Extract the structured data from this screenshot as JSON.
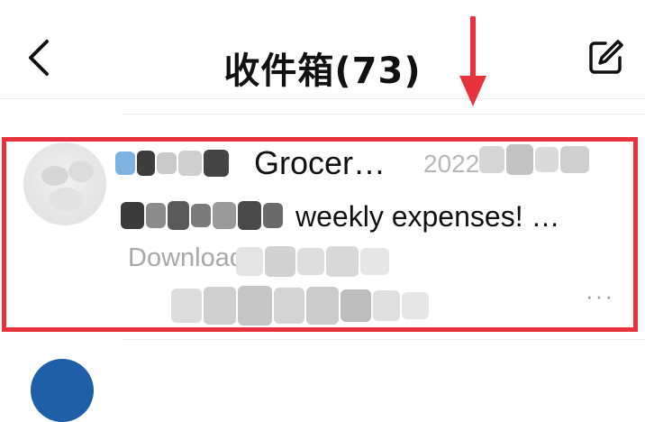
{
  "header": {
    "title": "收件箱(73)",
    "back_icon": "chevron-left-icon",
    "compose_icon": "compose-icon"
  },
  "colors": {
    "highlight": "#e8333f",
    "primary_text": "#111111",
    "secondary_text": "#a8a8a8",
    "date_text": "#b7b7b7"
  },
  "email": {
    "sender": "Grocer…",
    "date": "2022",
    "subject": "weekly expenses! …",
    "preview": "Download",
    "more_label": "···"
  }
}
